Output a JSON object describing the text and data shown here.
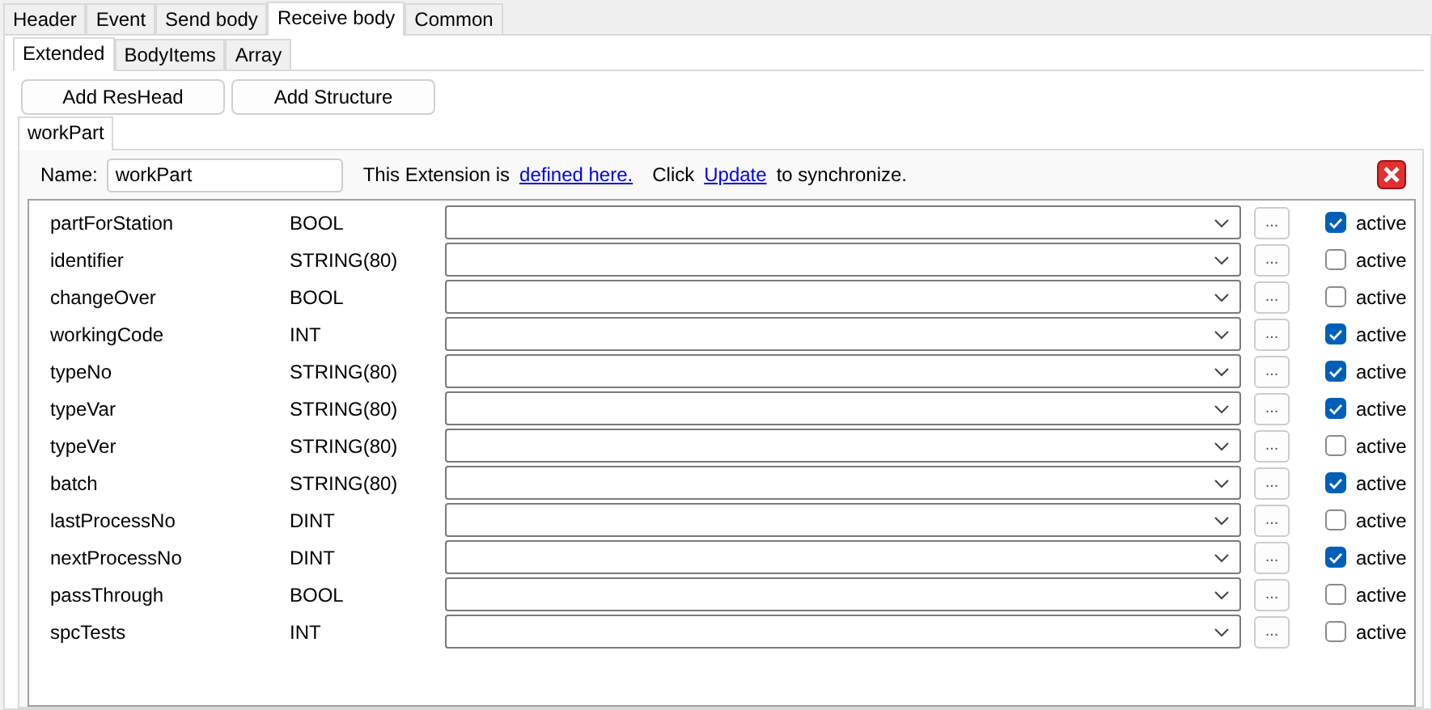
{
  "tabs": [
    {
      "label": "Header",
      "selected": false
    },
    {
      "label": "Event",
      "selected": false
    },
    {
      "label": "Send body",
      "selected": false
    },
    {
      "label": "Receive body",
      "selected": true
    },
    {
      "label": "Common",
      "selected": false
    }
  ],
  "sub_tabs": [
    {
      "label": "Extended",
      "selected": true
    },
    {
      "label": "BodyItems",
      "selected": false
    },
    {
      "label": "Array",
      "selected": false
    }
  ],
  "buttons": [
    "Add ResHead",
    "Add Structure"
  ],
  "extension_tabs": [
    {
      "label": "workPart",
      "selected": true
    }
  ],
  "name_row": {
    "label": "Name:",
    "value": "workPart",
    "text_before": "This Extension is",
    "link": "defined here.",
    "text_middle": "Click",
    "update_link": "Update",
    "text_after": "to synchronize."
  },
  "fields": [
    {
      "name": "partForStation",
      "type": "BOOL",
      "browse": "...",
      "active_label": "active",
      "checked": true
    },
    {
      "name": "identifier",
      "type": "STRING(80)",
      "browse": "...",
      "active_label": "active",
      "checked": false
    },
    {
      "name": "changeOver",
      "type": "BOOL",
      "browse": "...",
      "active_label": "active",
      "checked": false
    },
    {
      "name": "workingCode",
      "type": "INT",
      "browse": "...",
      "active_label": "active",
      "checked": true
    },
    {
      "name": "typeNo",
      "type": "STRING(80)",
      "browse": "...",
      "active_label": "active",
      "checked": true
    },
    {
      "name": "typeVar",
      "type": "STRING(80)",
      "browse": "...",
      "active_label": "active",
      "checked": true
    },
    {
      "name": "typeVer",
      "type": "STRING(80)",
      "browse": "...",
      "active_label": "active",
      "checked": false
    },
    {
      "name": "batch",
      "type": "STRING(80)",
      "browse": "...",
      "active_label": "active",
      "checked": true
    },
    {
      "name": "lastProcessNo",
      "type": "DINT",
      "browse": "...",
      "active_label": "active",
      "checked": false
    },
    {
      "name": "nextProcessNo",
      "type": "DINT",
      "browse": "...",
      "active_label": "active",
      "checked": true
    },
    {
      "name": "passThrough",
      "type": "BOOL",
      "browse": "...",
      "active_label": "active",
      "checked": false
    },
    {
      "name": "spcTests",
      "type": "INT",
      "browse": "...",
      "active_label": "active",
      "checked": false
    }
  ]
}
